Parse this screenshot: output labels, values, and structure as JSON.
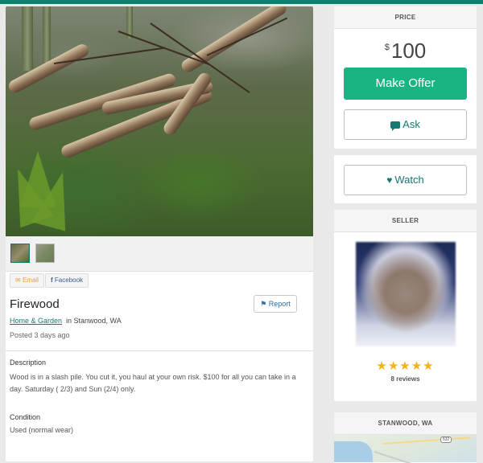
{
  "listing": {
    "title": "Firewood",
    "category": "Home & Garden",
    "location": "in Stanwood, WA",
    "posted": "Posted 3 days ago",
    "description_label": "Description",
    "description": "Wood is in a slash pile. You cut it, you haul at your own risk. $100 for all you can take in a day. Saturday ( 2/3) and Sun (2/4) only.",
    "condition_label": "Condition",
    "condition": "Used (normal wear)",
    "report_label": "Report",
    "share": {
      "email_label": "Email",
      "facebook_label": "Facebook"
    }
  },
  "price_panel": {
    "header": "PRICE",
    "currency": "$",
    "amount": "100",
    "make_offer_label": "Make Offer",
    "ask_label": "Ask"
  },
  "watch": {
    "label": "Watch"
  },
  "seller": {
    "header": "SELLER",
    "stars": "★★★★★",
    "reviews": "8 reviews"
  },
  "map": {
    "header": "STANWOOD, WA",
    "route_label": "532"
  },
  "colors": {
    "accent": "#16796f",
    "offer_button": "#19b384",
    "star": "#f2b21b"
  },
  "icons": [
    "email-icon",
    "facebook-icon",
    "flag-icon",
    "chat-icon",
    "heart-icon",
    "star-icon"
  ]
}
